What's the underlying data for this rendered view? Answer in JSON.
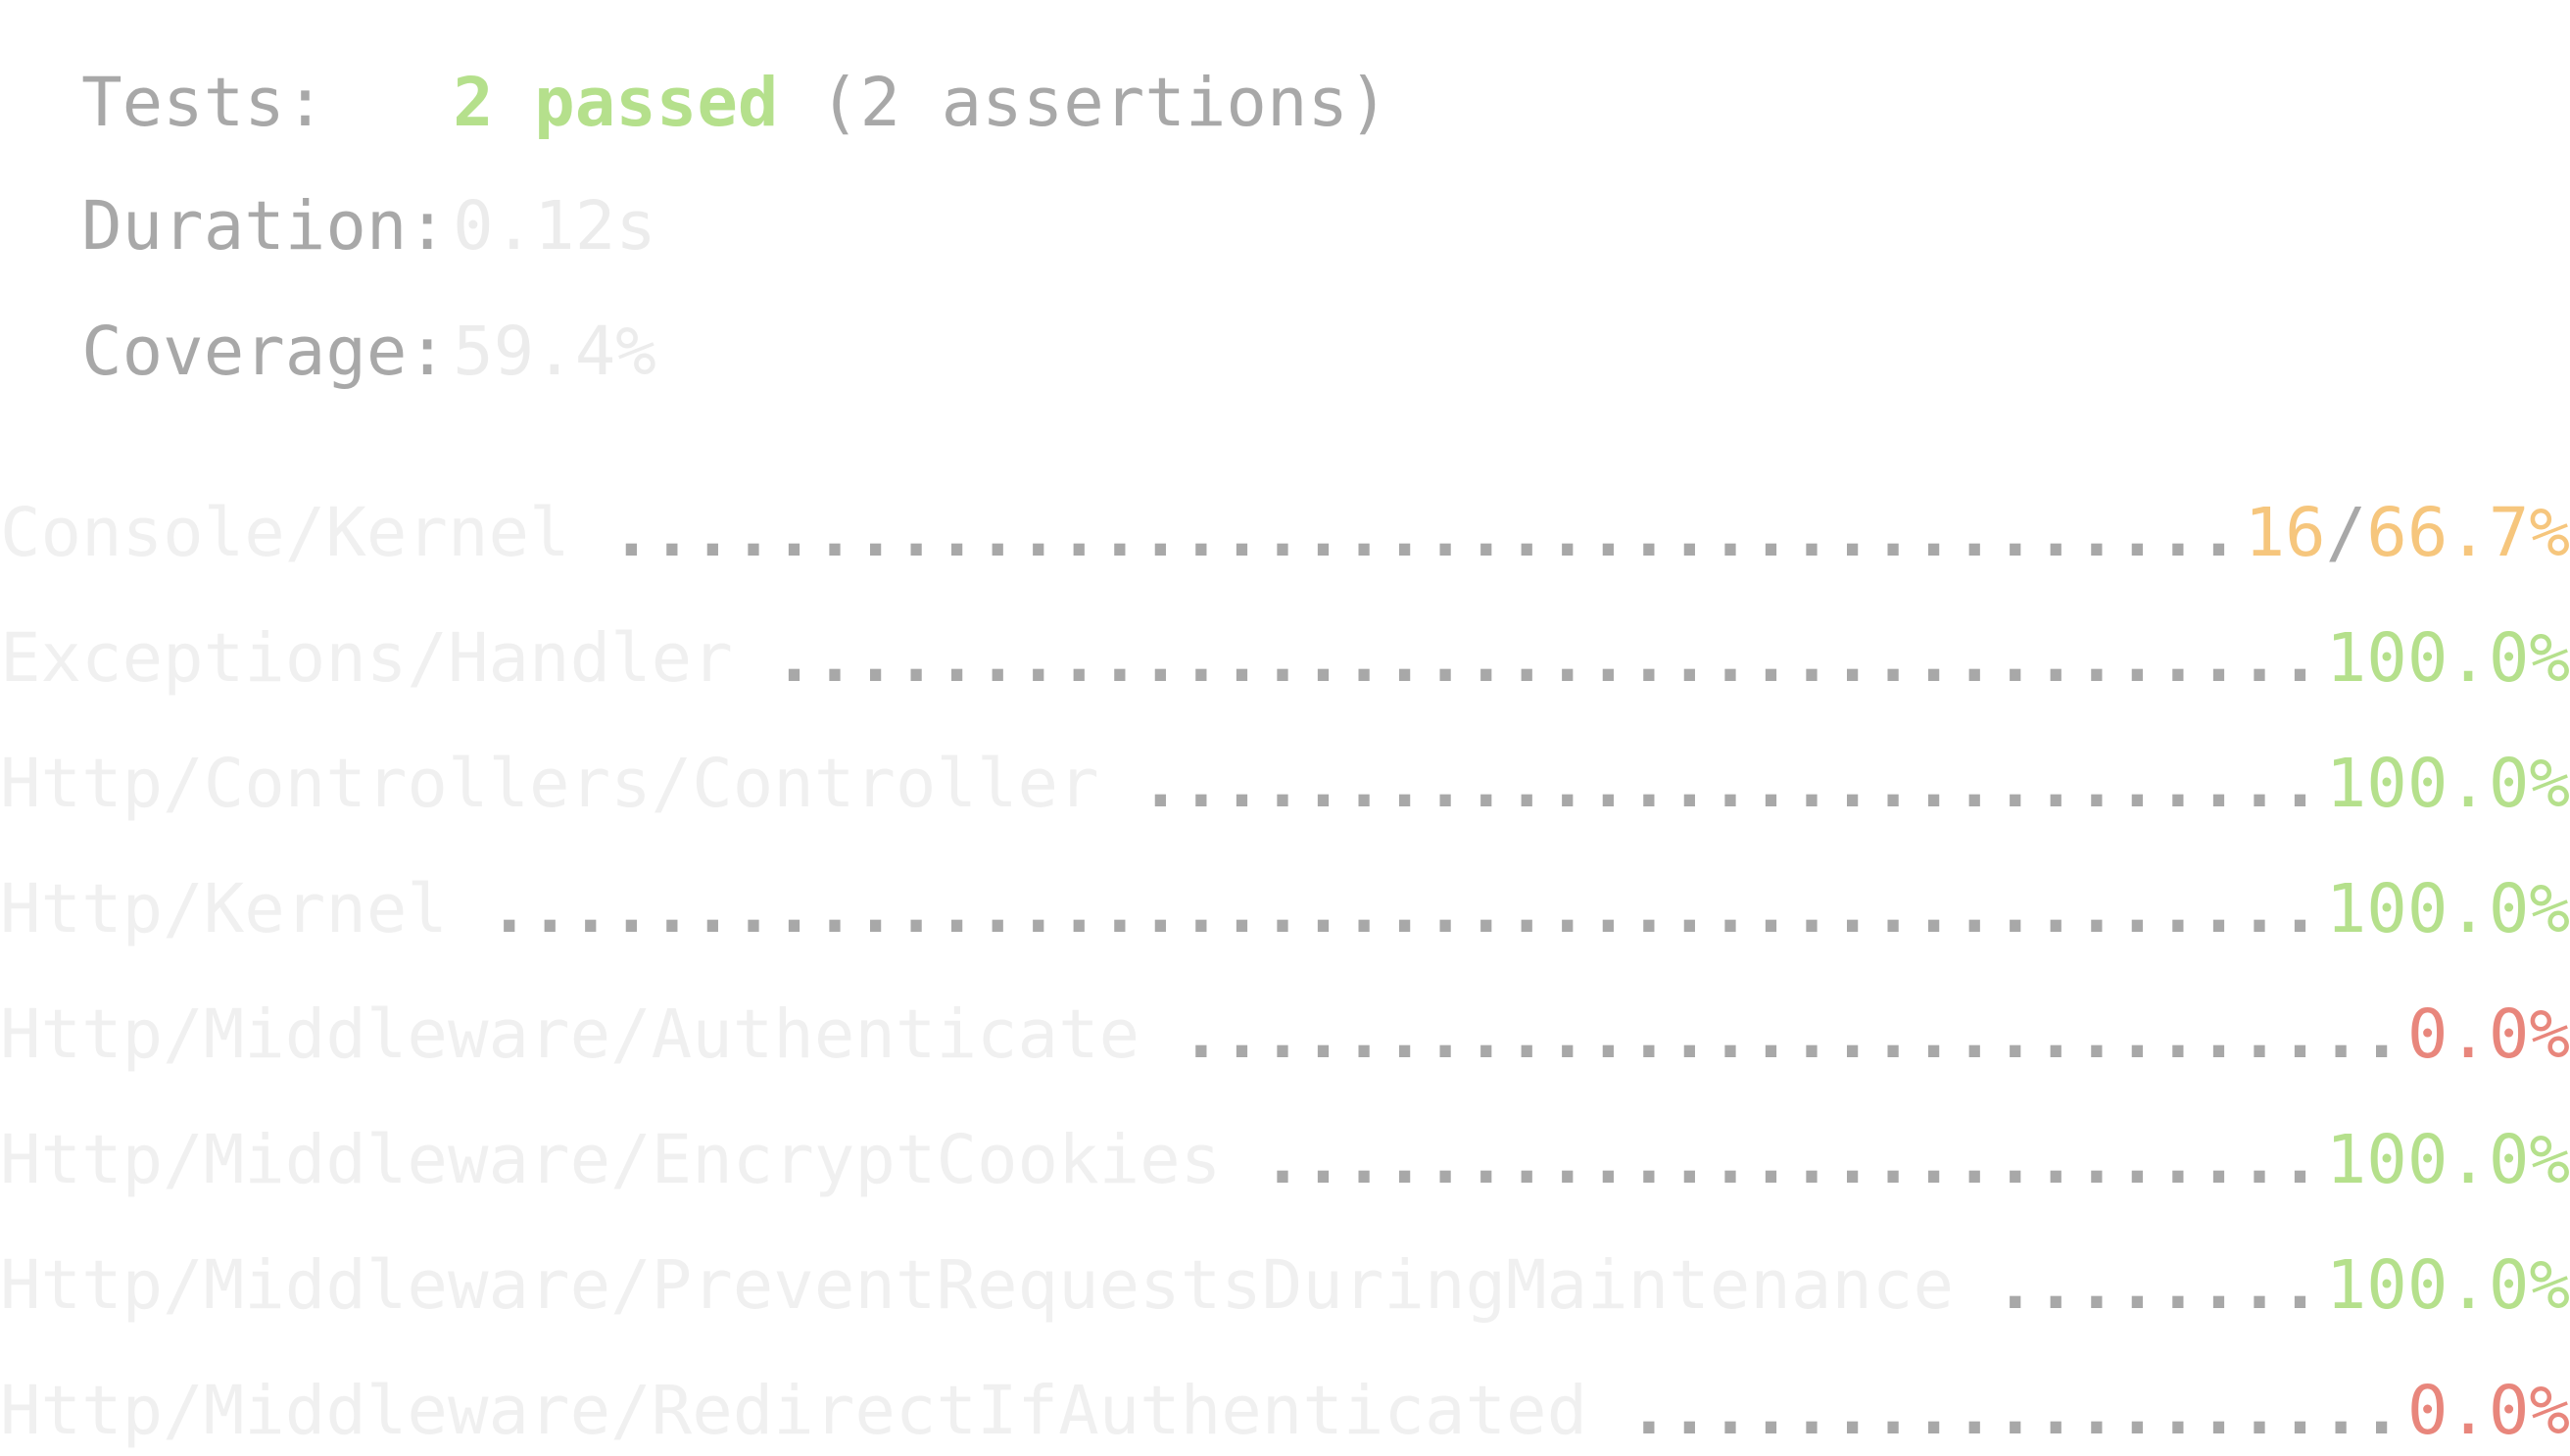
{
  "summary": {
    "tests_label": "Tests:",
    "tests_passed": "2 passed",
    "tests_assertions": "(2 assertions)",
    "duration_label": "Duration:",
    "duration_value": "0.12s",
    "coverage_label": "Coverage:",
    "coverage_value": "59.4%"
  },
  "coverage_rows": [
    {
      "name": "Console/Kernel",
      "uncovered": "16",
      "separator": "/",
      "percent": "66.7%",
      "level": "mid"
    },
    {
      "name": "Exceptions/Handler",
      "uncovered": "",
      "separator": "",
      "percent": "100.0%",
      "level": "high"
    },
    {
      "name": "Http/Controllers/Controller",
      "uncovered": "",
      "separator": "",
      "percent": "100.0%",
      "level": "high"
    },
    {
      "name": "Http/Kernel",
      "uncovered": "",
      "separator": "",
      "percent": "100.0%",
      "level": "high"
    },
    {
      "name": "Http/Middleware/Authenticate",
      "uncovered": "",
      "separator": "",
      "percent": "0.0%",
      "level": "low"
    },
    {
      "name": "Http/Middleware/EncryptCookies",
      "uncovered": "",
      "separator": "",
      "percent": "100.0%",
      "level": "high"
    },
    {
      "name": "Http/Middleware/PreventRequestsDuringMaintenance",
      "uncovered": "",
      "separator": "",
      "percent": "100.0%",
      "level": "high"
    },
    {
      "name": "Http/Middleware/RedirectIfAuthenticated",
      "uncovered": "",
      "separator": "",
      "percent": "0.0%",
      "level": "low"
    }
  ],
  "colors": {
    "high": "#b5e08c",
    "mid": "#f6c67d",
    "low": "#e8867c",
    "label": "#a8a8a8"
  }
}
